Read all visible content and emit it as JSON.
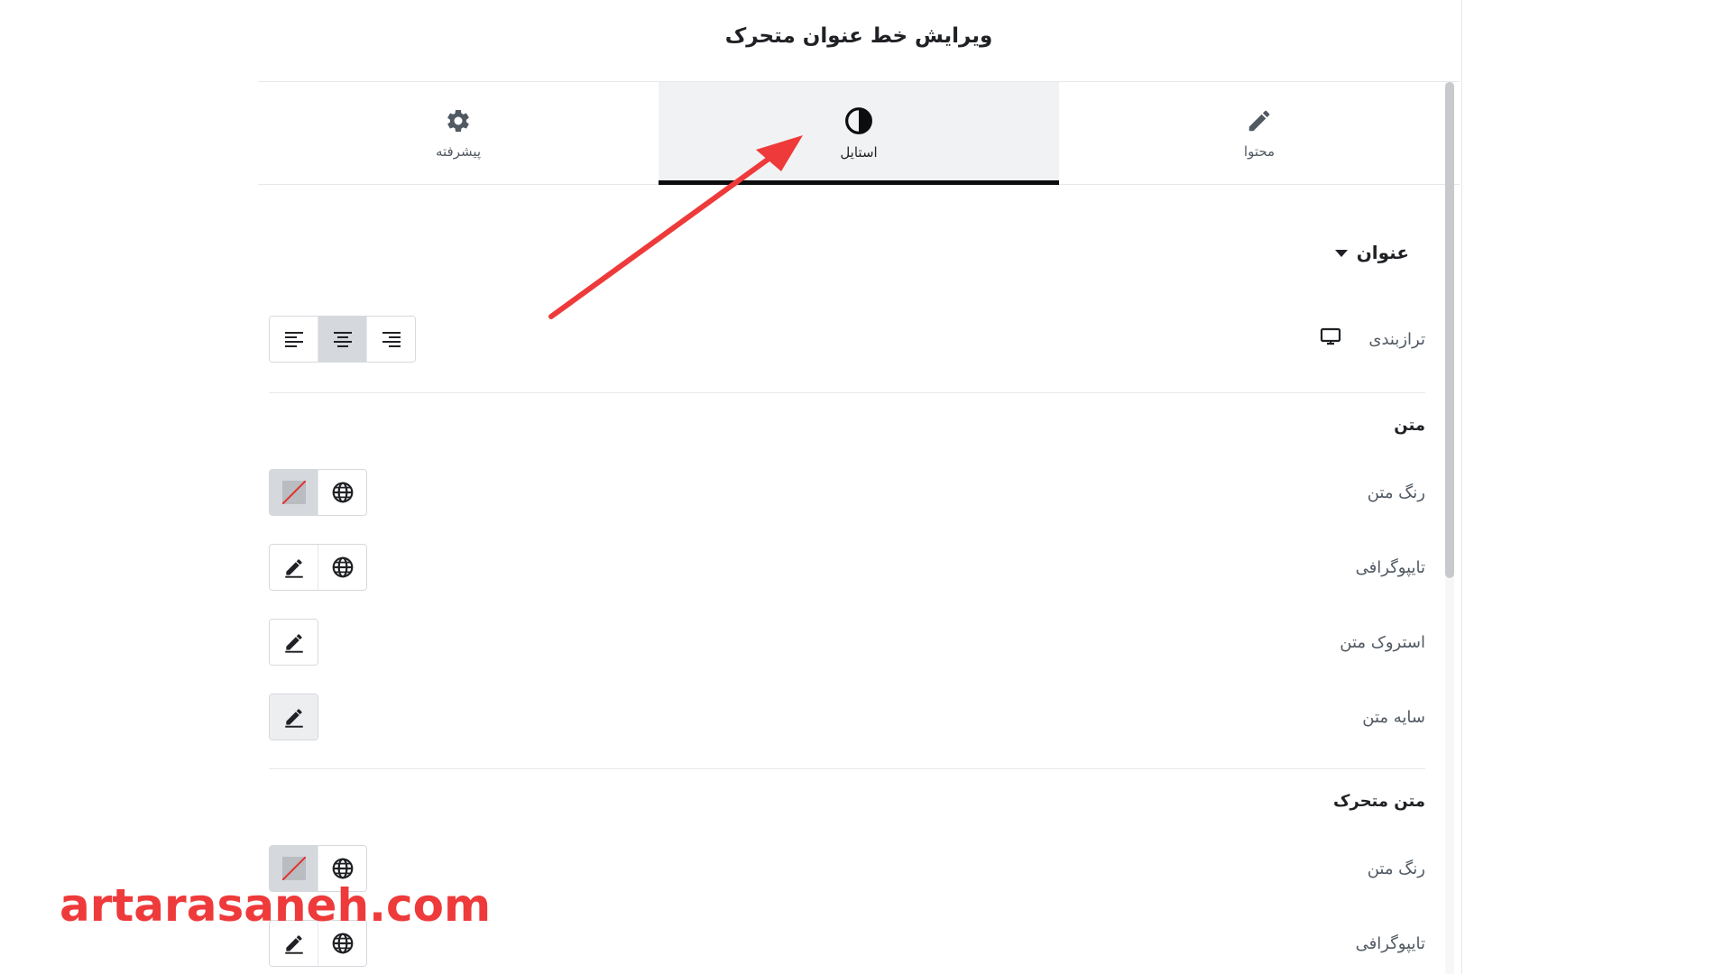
{
  "panel": {
    "title": "ویرایش خط عنوان متحرک"
  },
  "tabs": [
    {
      "label": "محتوا",
      "icon": "pencil-icon",
      "active": false
    },
    {
      "label": "استایل",
      "icon": "contrast-icon",
      "active": true
    },
    {
      "label": "پیشرفته",
      "icon": "gear-icon",
      "active": false
    }
  ],
  "section": {
    "title": "عنوان",
    "alignment": {
      "label": "ترازبندی",
      "device_icon": "desktop-icon",
      "options": [
        "align-right",
        "align-center",
        "align-left"
      ],
      "selected": "align-center"
    },
    "text_group": {
      "title": "متن",
      "text_color_label": "رنگ متن",
      "typography_label": "تایپوگرافی",
      "stroke_label": "استروک متن",
      "shadow_label": "سایه متن"
    },
    "animated_group": {
      "title": "متن متحرک",
      "text_color_label": "رنگ متن",
      "typography_label": "تایپوگرافی"
    }
  },
  "annotation": {
    "watermark_text": "artarasaneh.com",
    "color": "#ee3a3a"
  }
}
